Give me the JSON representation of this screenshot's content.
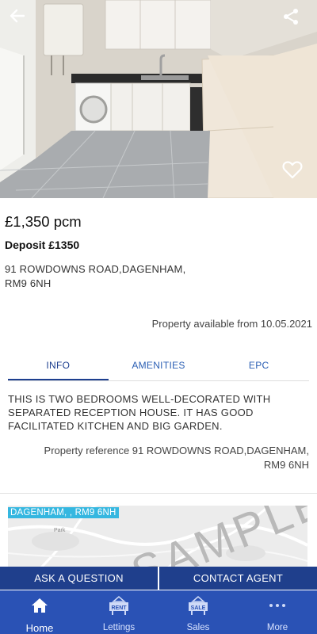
{
  "hero": {
    "icons": {
      "back": "arrow-left-icon",
      "share": "share-icon",
      "favorite": "heart-outline-icon"
    }
  },
  "listing": {
    "price": "£1,350 pcm",
    "deposit": "Deposit £1350",
    "address_line1": "91 ROWDOWNS ROAD,DAGENHAM,",
    "address_line2": "RM9 6NH",
    "available": "Property available from 10.05.2021"
  },
  "tabs": [
    {
      "label": "INFO",
      "active": true
    },
    {
      "label": "AMENITIES",
      "active": false
    },
    {
      "label": "EPC",
      "active": false
    }
  ],
  "info": {
    "description": "THIS IS TWO BEDROOMS WELL-DECORATED WITH SEPARATED RECEPTION HOUSE. IT HAS GOOD FACILITATED KITCHEN AND BIG GARDEN.",
    "reference_line1": "Property reference 91 ROWDOWNS ROAD,DAGENHAM,",
    "reference_line2": "RM9 6NH"
  },
  "map": {
    "label": "DAGENHAM, , RM9 6NH",
    "watermark": "SAMPLE",
    "place": "Park"
  },
  "actions": {
    "ask": "ASK A QUESTION",
    "contact": "CONTACT AGENT"
  },
  "nav": {
    "items": [
      {
        "label": "Home",
        "icon": "home-icon",
        "badge": ""
      },
      {
        "label": "Lettings",
        "icon": "rent-sign-icon",
        "badge": "RENT"
      },
      {
        "label": "Sales",
        "icon": "sale-sign-icon",
        "badge": "SALE"
      },
      {
        "label": "More",
        "icon": "more-dots-icon",
        "badge": "···"
      }
    ]
  },
  "colors": {
    "primary": "#1f3f8c",
    "nav": "#2a52b5",
    "tab_active": "#1d3f8f",
    "map_label": "#35b7e0"
  }
}
